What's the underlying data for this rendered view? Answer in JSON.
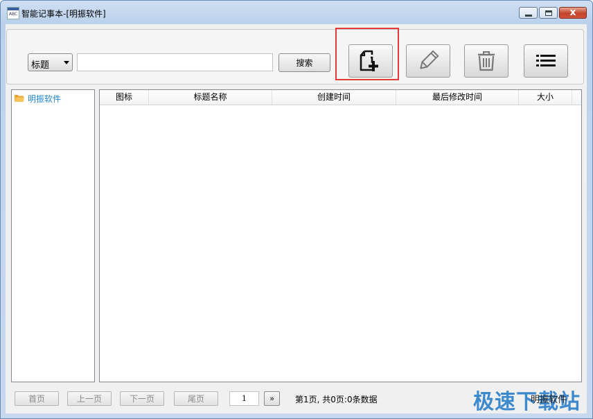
{
  "window": {
    "title": "智能记事本-[明振软件]",
    "app_icon_text": "ABC",
    "close_glyph": "x"
  },
  "search": {
    "field_select": "标题",
    "query": "",
    "placeholder": "",
    "button_label": "搜索"
  },
  "toolbar": {
    "new_icon": "new-document-icon",
    "edit_icon": "pencil-icon",
    "delete_icon": "trash-icon",
    "list_icon": "list-icon",
    "highlight_color": "#e43a3a"
  },
  "tree": {
    "root_label": "明振软件",
    "label_color": "#1f86d6"
  },
  "list": {
    "columns": [
      "图标",
      "标题名称",
      "创建时间",
      "最后修改时间",
      "大小"
    ],
    "rows": []
  },
  "pager": {
    "first": "首页",
    "prev": "上一页",
    "next": "下一页",
    "last": "尾页",
    "page_input": "1",
    "go": "»",
    "info": "第1页, 共0页:0条数据"
  },
  "watermark": {
    "text": "极速下载站",
    "sub": "明振软件"
  }
}
